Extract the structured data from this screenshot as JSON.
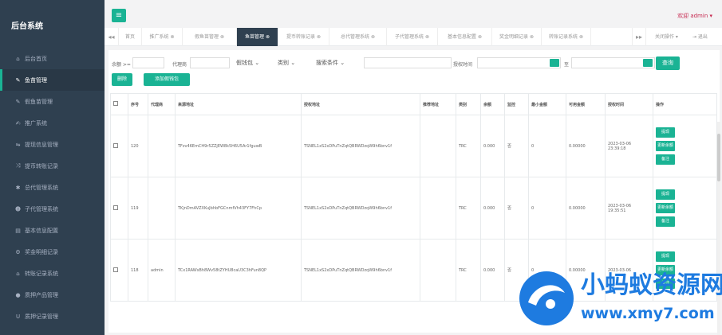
{
  "sidebar": {
    "brand": "后台系统",
    "items": [
      {
        "icon": "home-icon",
        "glyph": "⌂",
        "label": "后台首页"
      },
      {
        "icon": "wrench-icon",
        "glyph": "✎",
        "label": "鱼苗管理"
      },
      {
        "icon": "wrench-icon",
        "glyph": "✎",
        "label": "假鱼苗管理"
      },
      {
        "icon": "edit-icon",
        "glyph": "✍",
        "label": "推广系统"
      },
      {
        "icon": "withdraw-icon",
        "glyph": "⇋",
        "label": "提现信息管理"
      },
      {
        "icon": "shuffle-icon",
        "glyph": "⤨",
        "label": "提币转账记录"
      },
      {
        "icon": "star-icon",
        "glyph": "✱",
        "label": "总代管理系统"
      },
      {
        "icon": "users-icon",
        "glyph": "☻",
        "label": "子代管理系统"
      },
      {
        "icon": "file-icon",
        "glyph": "▤",
        "label": "基本信息配置"
      },
      {
        "icon": "gears-icon",
        "glyph": "⚙",
        "label": "奖金明细记录"
      },
      {
        "icon": "bank-icon",
        "glyph": "⌂",
        "label": "转账记录系统"
      },
      {
        "icon": "chat-icon",
        "glyph": "●",
        "label": "质押产品管理"
      },
      {
        "icon": "magnet-icon",
        "glyph": "U",
        "label": "质押记录管理"
      }
    ]
  },
  "header": {
    "welcome": "欢迎 admin ▾"
  },
  "tabs": {
    "prev": "◂◂",
    "next": "▸▸",
    "items": [
      {
        "label": "首页",
        "active": false
      },
      {
        "label": "推广系统 ⊗",
        "active": false
      },
      {
        "label": "假鱼苗管理 ⊗",
        "active": false
      },
      {
        "label": "鱼苗管理 ⊗",
        "active": true
      },
      {
        "label": "提币转账记录 ⊗",
        "active": false
      },
      {
        "label": "总代管理系统 ⊗",
        "active": false
      },
      {
        "label": "子代管理系统 ⊗",
        "active": false
      },
      {
        "label": "基本信息配置 ⊗",
        "active": false
      },
      {
        "label": "奖金明细记录 ⊗",
        "active": false
      },
      {
        "label": "转账记录系统 ⊗",
        "active": false
      }
    ],
    "close_ops": "关闭操作 ▾",
    "logout": "⇥ 退出"
  },
  "filters": {
    "balance_label": "余额 >=",
    "agent_label": "代理商",
    "wallet_select": "假钱包",
    "type_select": "类别",
    "search_select": "搜索条件",
    "auth_time_label": "授权时间",
    "to_label": "至",
    "search_button": "查询",
    "delete_button": "删除",
    "add_wallet_button": "添加假钱包"
  },
  "table": {
    "columns": [
      "",
      "序号",
      "代理商",
      "来源地址",
      "授权地址",
      "推荐地址",
      "类别",
      "余额",
      "监控",
      "最小金额",
      "可用金额",
      "授权时间",
      "操作"
    ],
    "rows": [
      {
        "id": "120",
        "agent": "",
        "source": "TFzv46EmCH9r5ZZjEW8k5H6U5Ar1fguwB",
        "auth": "TSNEL1xS2xDPuTnZqtQBRWDzqW9h6bnv1f",
        "ref": "",
        "type": "TRC",
        "balance": "0.000",
        "monitor": "否",
        "min": "0",
        "available": "0.00000",
        "auth_time": "2023-03-06 23:39:18"
      },
      {
        "id": "119",
        "agent": "",
        "source": "TKjnDmAVZXKuJbhbFGCnmfVh43FY7FhCp",
        "auth": "TSNEL1xS2xDPuTnZqtQBRWDzqW9h6bnv1f",
        "ref": "",
        "type": "TRC",
        "balance": "0.000",
        "monitor": "否",
        "min": "0",
        "available": "0.00000",
        "auth_time": "2023-03-06 19:35:51"
      },
      {
        "id": "118",
        "agent": "admin",
        "source": "TCx1RAWsBh8Wv58tZYHU8caU3C3hFun8QP",
        "auth": "TSNEL1xS2xDPuTnZqtQBRWDzqW9h6bnv1f",
        "ref": "",
        "type": "TRC",
        "balance": "0.000",
        "monitor": "否",
        "min": "0",
        "available": "0.00000",
        "auth_time": "2023-03-06"
      }
    ],
    "ops": [
      "提现",
      "更新余额",
      "备注"
    ]
  },
  "watermark": {
    "title": "小蚂蚁资源网",
    "url": "www.xmy7.com"
  },
  "colors": {
    "sidebar": "#2f4050",
    "accent": "#1ab394",
    "link": "#1c84c6",
    "watermark": "#1e7be0"
  }
}
